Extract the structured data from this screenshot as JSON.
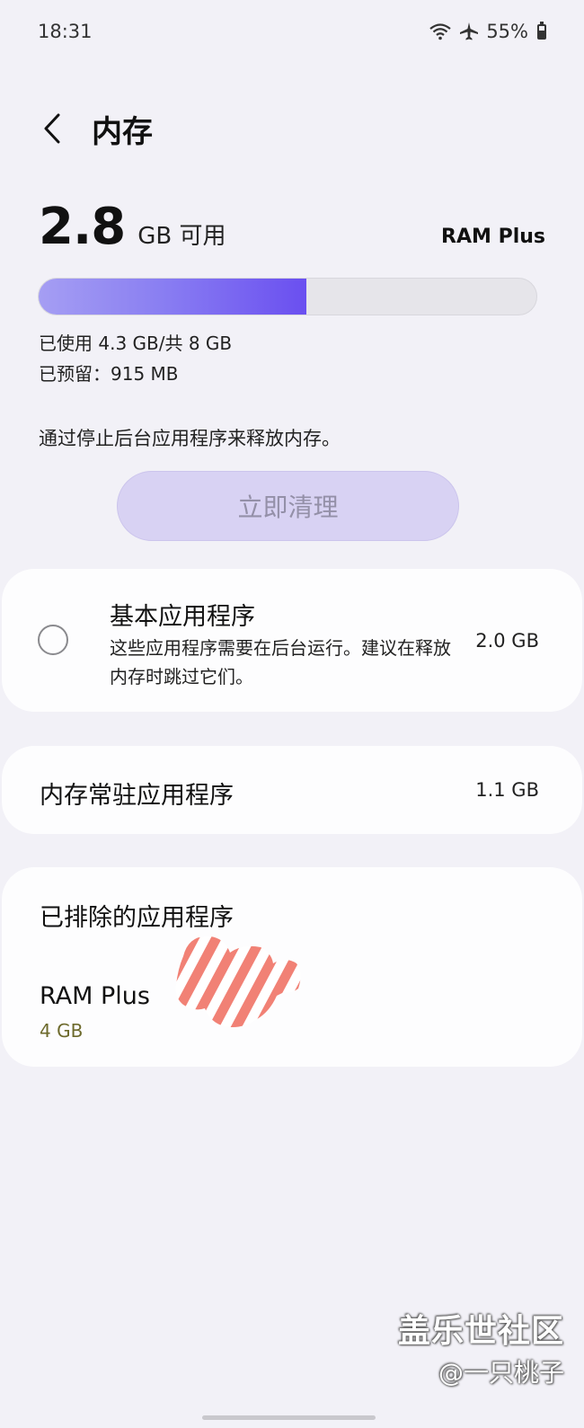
{
  "status": {
    "time": "18:31",
    "battery": "55%",
    "icons": [
      "wifi-icon",
      "airplane-icon",
      "battery-icon"
    ]
  },
  "header": {
    "title": "内存"
  },
  "memory": {
    "available_value": "2.8",
    "available_unit": "GB 可用",
    "ram_plus_label": "RAM Plus",
    "used_fraction": 0.5375,
    "used_text": "已使用 4.3 GB/共 8 GB",
    "reserved_text": "已预留：915 MB"
  },
  "clean": {
    "hint": "通过停止后台应用程序来释放内存。",
    "button_label": "立即清理"
  },
  "basic_apps": {
    "title": "基本应用程序",
    "description": "这些应用程序需要在后台运行。建议在释放内存时跳过它们。",
    "size": "2.0 GB"
  },
  "resident_apps": {
    "title": "内存常驻应用程序",
    "size": "1.1 GB"
  },
  "excluded_apps": {
    "title": "已排除的应用程序",
    "items": [
      {
        "name": "RAM Plus",
        "size": "4 GB"
      }
    ]
  },
  "watermark": {
    "line1": "盖乐世社区",
    "line2": "@一只桃子"
  },
  "colors": {
    "background": "#f2f1f7",
    "card": "#fdfdfe",
    "progress_fill": "#6a4ff0",
    "button_bg": "#d8d2f3",
    "excluded_size": "#6d6a2c"
  }
}
